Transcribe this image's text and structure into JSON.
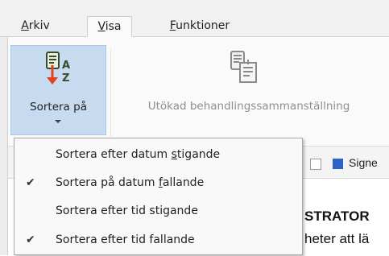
{
  "tabs": [
    {
      "pre": "",
      "key": "A",
      "post": "rkiv",
      "active": false
    },
    {
      "pre": "",
      "key": "V",
      "post": "isa",
      "active": true
    },
    {
      "pre": "",
      "key": "F",
      "post": "unktioner",
      "active": false
    }
  ],
  "ribbon": {
    "sort_button": {
      "label": "Sortera på",
      "icon": "sort-az-icon"
    },
    "summary_button": {
      "label": "Utökad behandlingssammanställning",
      "icon": "summary-list-icon",
      "disabled": true
    }
  },
  "menu": {
    "items": [
      {
        "pre": "Sortera efter datum ",
        "key": "s",
        "post": "tigande",
        "checked": false
      },
      {
        "pre": "Sortera på datum ",
        "key": "f",
        "post": "allande",
        "checked": true
      },
      {
        "pre": "Sortera efter tid stigande",
        "key": "",
        "post": "",
        "checked": false
      },
      {
        "pre": "Sortera efter tid fallande",
        "key": "",
        "post": "",
        "checked": true
      }
    ],
    "check_glyph": "✔"
  },
  "background": {
    "signe_text": "Signe",
    "admin_text": "STRATOR",
    "line_text": "heter att lä"
  },
  "colors": {
    "accent": "#c7dbf0",
    "sort_arrow": "#e0431c",
    "chip": "#2b64c6"
  }
}
